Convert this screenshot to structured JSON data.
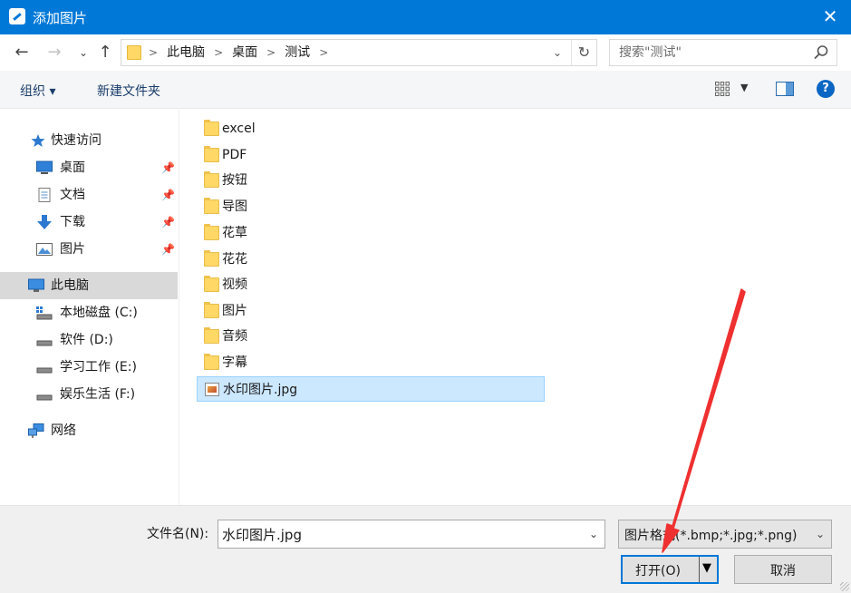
{
  "window": {
    "title": "添加图片",
    "close_glyph": "✕"
  },
  "nav": {
    "back": "←",
    "forward": "→",
    "recent": "⌄",
    "up": "↑",
    "breadcrumb": [
      ">",
      "此电脑",
      ">",
      "桌面",
      ">",
      "测试",
      ">"
    ],
    "address_dropdown": "⌄",
    "refresh": "↻",
    "search_placeholder": "搜索\"测试\""
  },
  "toolbar": {
    "organize": "组织 ▾",
    "new_folder": "新建文件夹",
    "view_dropdown": "▼",
    "help": "?"
  },
  "sidebar": {
    "items": [
      {
        "label": "快速访问",
        "icon": "star-icon",
        "pinned": false
      },
      {
        "label": "桌面",
        "icon": "desktop-icon",
        "pinned": true
      },
      {
        "label": "文档",
        "icon": "document-icon",
        "pinned": true
      },
      {
        "label": "下载",
        "icon": "download-icon",
        "pinned": true
      },
      {
        "label": "图片",
        "icon": "pictures-icon",
        "pinned": true
      },
      {
        "label": "此电脑",
        "icon": "computer-icon",
        "pinned": false,
        "selected": true
      },
      {
        "label": "本地磁盘 (C:)",
        "icon": "system-drive-icon",
        "pinned": false
      },
      {
        "label": "软件 (D:)",
        "icon": "drive-icon",
        "pinned": false
      },
      {
        "label": "学习工作 (E:)",
        "icon": "drive-icon",
        "pinned": false
      },
      {
        "label": "娱乐生活 (F:)",
        "icon": "drive-icon",
        "pinned": false
      },
      {
        "label": "网络",
        "icon": "network-icon",
        "pinned": false
      }
    ],
    "pin_glyph": "📌"
  },
  "files": [
    {
      "name": "excel",
      "type": "folder"
    },
    {
      "name": "PDF",
      "type": "folder"
    },
    {
      "name": "按钮",
      "type": "folder"
    },
    {
      "name": "导图",
      "type": "folder"
    },
    {
      "name": "花草",
      "type": "folder"
    },
    {
      "name": "花花",
      "type": "folder"
    },
    {
      "name": "视频",
      "type": "folder"
    },
    {
      "name": "图片",
      "type": "folder"
    },
    {
      "name": "音频",
      "type": "folder"
    },
    {
      "name": "字幕",
      "type": "folder"
    },
    {
      "name": "水印图片.jpg",
      "type": "image",
      "selected": true
    }
  ],
  "bottom": {
    "filename_label": "文件名(N):",
    "filename_value": "水印图片.jpg",
    "filter_value": "图片格式(*.bmp;*.jpg;*.png)",
    "dropdown_glyph": "⌄",
    "open_label": "打开(O)",
    "open_arrow": "▼",
    "cancel_label": "取消"
  },
  "colors": {
    "titlebar": "#0078d7",
    "selection": "#cce8ff",
    "annotation_arrow": "#ef3030"
  }
}
